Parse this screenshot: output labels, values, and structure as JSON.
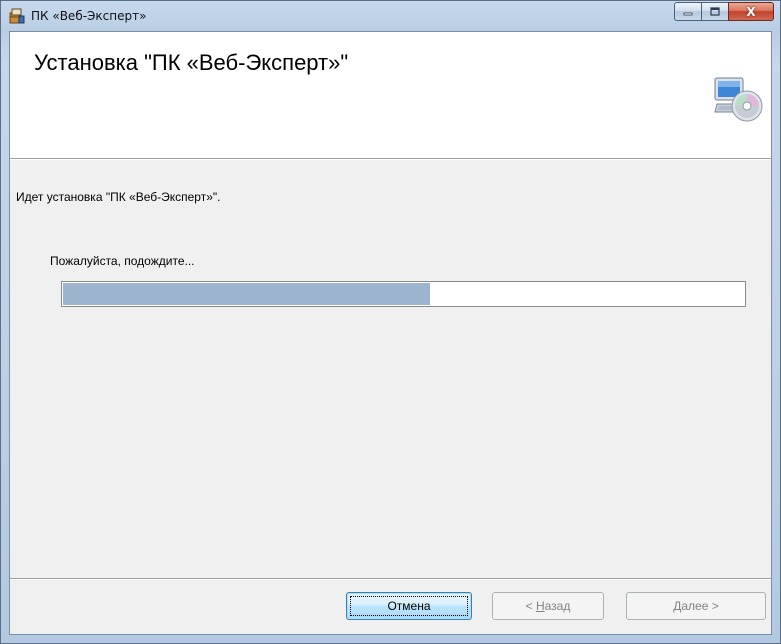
{
  "window": {
    "title": "ПК «Веб-Эксперт»",
    "close_glyph": "X"
  },
  "header": {
    "title": "Установка \"ПК «Веб-Эксперт»\"",
    "icon": "computer-cd-setup-icon"
  },
  "body": {
    "status": "Идет установка \"ПК «Веб-Эксперт»\".",
    "wait_label": "Пожалуйста, подождите..."
  },
  "progress": {
    "percent": 54,
    "fill_color": "#9db4cf"
  },
  "buttons": {
    "cancel": "Отмена",
    "back_prefix": "< ",
    "back_accel": "Н",
    "back_rest": "азад",
    "next_accel": "Д",
    "next_rest": "алее >"
  },
  "colors": {
    "frame": "#b9cde4",
    "close_button": "#c4412a",
    "focus_button": "#3c7fb1"
  }
}
